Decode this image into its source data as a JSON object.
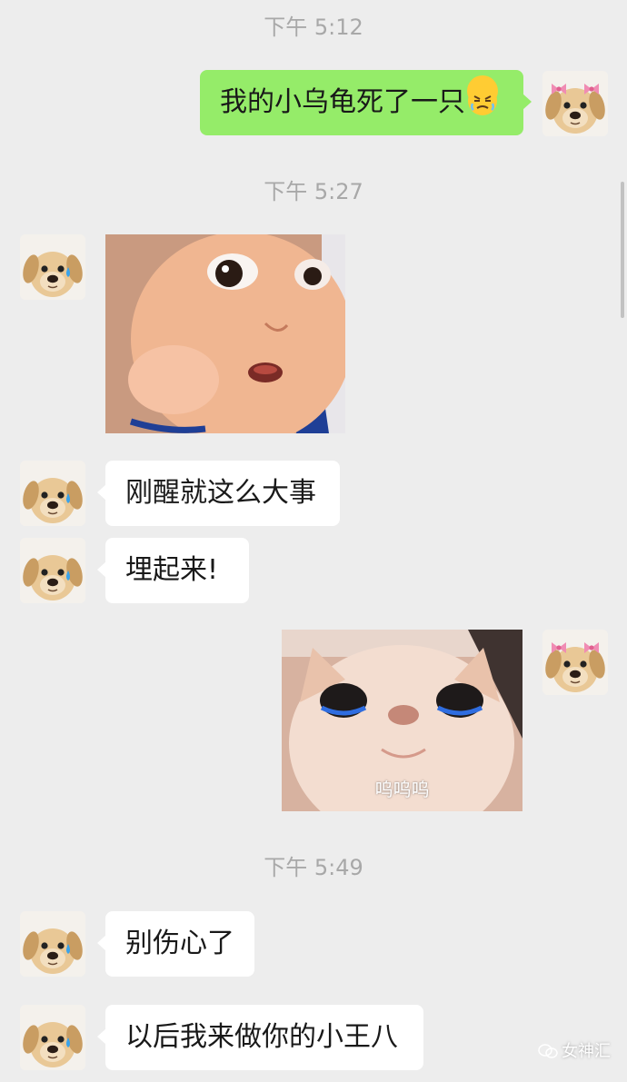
{
  "timestamps": [
    "下午 5:12",
    "下午 5:27",
    "下午 5:49"
  ],
  "messages": {
    "m1": {
      "text": "我的小乌龟死了一只",
      "emoji": "angry-face-emoji"
    },
    "m2": {
      "sticker": "startled-baby-sticker"
    },
    "m3": {
      "text": "刚醒就这么大事"
    },
    "m4": {
      "text": "埋起来!"
    },
    "m5": {
      "sticker": "crying-cat-sticker",
      "caption": "呜呜呜"
    },
    "m6": {
      "text": "别伤心了"
    },
    "m7": {
      "text": "以后我来做你的小王八"
    }
  },
  "avatars": {
    "self": "dog-with-bows-avatar",
    "contact": "crying-dog-avatar"
  },
  "watermark": "女神汇",
  "colors": {
    "background": "#ededed",
    "outgoing_bubble": "#95ec69",
    "incoming_bubble": "#ffffff",
    "timestamp_text": "#a8a8a8"
  }
}
